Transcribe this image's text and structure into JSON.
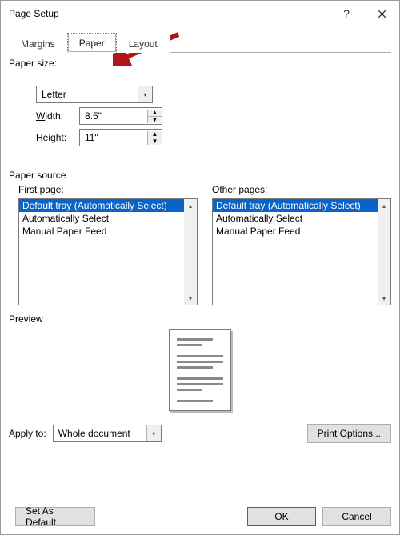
{
  "window": {
    "title": "Page Setup"
  },
  "tabs": {
    "margins": "Margins",
    "paper": "Paper",
    "layout": "Layout"
  },
  "paperSize": {
    "groupLabel": "Paper size:",
    "selected": "Letter",
    "widthLabel": "Width:",
    "widthValue": "8.5\"",
    "heightLabel": "Height:",
    "heightValue": "11\""
  },
  "paperSource": {
    "groupLabel": "Paper source",
    "firstPageLabel": "First page:",
    "otherPagesLabel": "Other pages:",
    "options": [
      "Default tray (Automatically Select)",
      "Automatically Select",
      "Manual Paper Feed"
    ]
  },
  "preview": {
    "label": "Preview"
  },
  "applyTo": {
    "label": "Apply to:",
    "value": "Whole document"
  },
  "buttons": {
    "printOptions": "Print Options...",
    "setDefault": "Set As Default",
    "ok": "OK",
    "cancel": "Cancel"
  }
}
